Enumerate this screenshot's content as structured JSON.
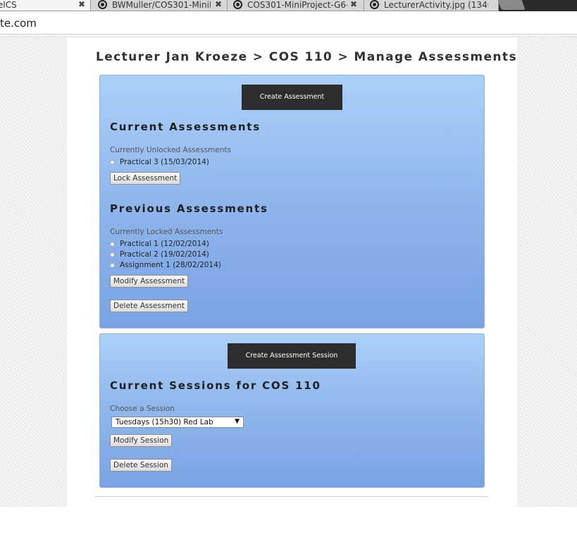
{
  "browser": {
    "tabs": [
      {
        "title": "elCS"
      },
      {
        "title": "BWMuller/COS301-MiniP"
      },
      {
        "title": "COS301-MiniProject-G6-P"
      },
      {
        "title": "LecturerActivity.jpg (1346"
      }
    ],
    "url": "te.com"
  },
  "page": {
    "breadcrumb": "Lecturer Jan Kroeze > COS 110 > Manage Assessments"
  },
  "assessments_panel": {
    "create_button": "Create Assessment",
    "current_heading": "Current Assessments",
    "unlocked_label": "Currently Unlocked Assessments",
    "unlocked_items": [
      {
        "label": "Practical 3 (15/03/2014)"
      }
    ],
    "lock_button": "Lock Assessment",
    "previous_heading": "Previous Assessments",
    "locked_label": "Currently Locked Assessments",
    "locked_items": [
      {
        "label": "Practical 1 (12/02/2014)"
      },
      {
        "label": "Practical 2 (19/02/2014)"
      },
      {
        "label": "Assignment 1 (28/02/2014)"
      }
    ],
    "modify_button": "Modify Assessment",
    "delete_button": "Delete Assessment"
  },
  "sessions_panel": {
    "create_button": "Create Assessment Session",
    "heading": "Current Sessions for COS 110",
    "choose_label": "Choose a Session",
    "selected_session": "Tuesdays (15h30) Red Lab",
    "modify_button": "Modify Session",
    "delete_button": "Delete Session"
  }
}
